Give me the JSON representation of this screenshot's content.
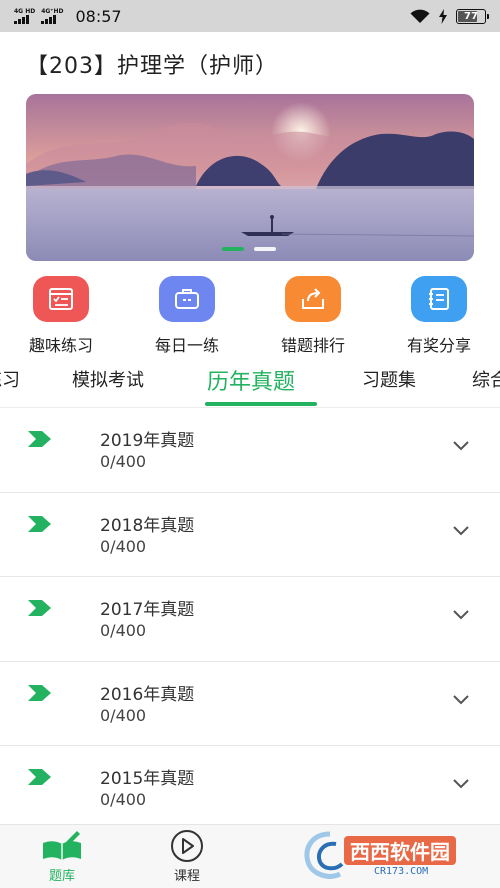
{
  "status_bar": {
    "signal_1_label": "4G HD",
    "signal_2_label": "4G⁺HD",
    "time": "08:57",
    "battery_level": "77",
    "battery_fraction": 0.77
  },
  "header": {
    "course_title": "【203】护理学（护师）"
  },
  "banner": {
    "slide_count": 2,
    "active_slide": 1
  },
  "quick_actions": [
    {
      "label": "趣味练习",
      "icon": "checklist-icon",
      "color": "#ef5757"
    },
    {
      "label": "每日一练",
      "icon": "briefcase-icon",
      "color": "#6d86f0"
    },
    {
      "label": "错题排行",
      "icon": "share-box-icon",
      "color": "#f78a33"
    },
    {
      "label": "有奖分享",
      "icon": "notebook-icon",
      "color": "#3f9ff0"
    }
  ],
  "tabs": [
    {
      "label": "练习"
    },
    {
      "label": "模拟考试"
    },
    {
      "label": "历年真题"
    },
    {
      "label": "习题集"
    },
    {
      "label": "综合"
    }
  ],
  "active_tab": "历年真题",
  "exam_list": [
    {
      "title": "2019年真题",
      "progress": "0/400"
    },
    {
      "title": "2018年真题",
      "progress": "0/400"
    },
    {
      "title": "2017年真题",
      "progress": "0/400"
    },
    {
      "title": "2016年真题",
      "progress": "0/400"
    },
    {
      "title": "2015年真题",
      "progress": "0/400"
    }
  ],
  "bottom_nav": [
    {
      "label": "题库",
      "icon": "book-pen-icon",
      "active": true
    },
    {
      "label": "课程",
      "icon": "play-circle-icon",
      "active": false
    }
  ],
  "watermark": {
    "text": "西西软件园",
    "url": "CR173.COM"
  },
  "colors": {
    "accent": "#23b25f",
    "status_bar": "#d6d6d6"
  }
}
